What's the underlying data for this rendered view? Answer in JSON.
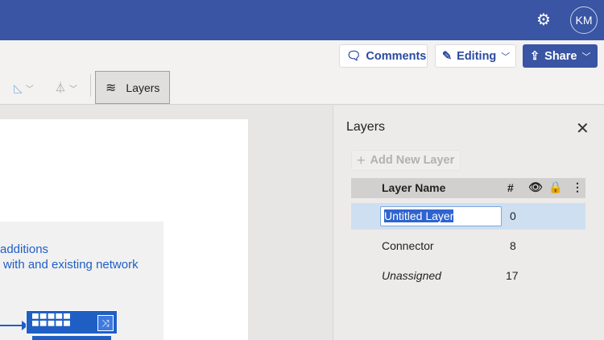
{
  "header": {
    "avatar_initials": "KM",
    "settings_icon": "gear-icon"
  },
  "toolbar": {
    "comments_label": "Comments",
    "editing_label": "Editing",
    "share_label": "Share",
    "layers_label": "Layers"
  },
  "canvas": {
    "text_line1": "additions",
    "text_line2": "with and existing network"
  },
  "layers_panel": {
    "title": "Layers",
    "add_label": "Add New Layer",
    "columns": {
      "name": "Layer Name",
      "count": "#"
    },
    "rows": [
      {
        "name": "Untitled Layer",
        "count": "0",
        "editing": true
      },
      {
        "name": "Connector",
        "count": "8"
      },
      {
        "name": "Unassigned",
        "count": "17"
      }
    ]
  },
  "colors": {
    "brand": "#3955a3",
    "selection": "#cfdff2"
  }
}
